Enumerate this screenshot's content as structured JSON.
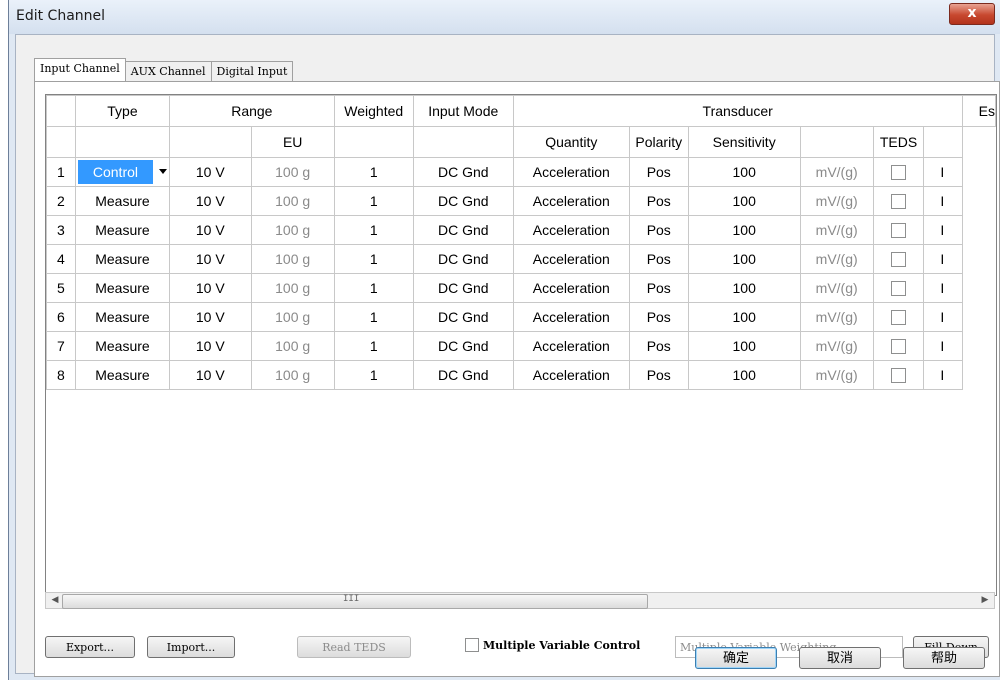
{
  "window": {
    "title": "Edit Channel",
    "close_glyph": "x"
  },
  "tabs": [
    {
      "label": "Input Channel"
    },
    {
      "label": "AUX Channel"
    },
    {
      "label": "Digital Input"
    }
  ],
  "grid": {
    "headers_top": {
      "type": "Type",
      "range": "Range",
      "weighted": "Weighted",
      "input_mode": "Input Mode",
      "transducer": "Transducer",
      "es": "Es"
    },
    "headers_sub": {
      "eu": "EU",
      "quantity": "Quantity",
      "polarity": "Polarity",
      "sensitivity": "Sensitivity",
      "teds": "TEDS"
    },
    "rows": [
      {
        "num": "1",
        "type": "Control",
        "range": "10 V",
        "eu": "100 g",
        "weighted": "1",
        "input_mode": "DC Gnd",
        "quantity": "Acceleration",
        "polarity": "Pos",
        "sensitivity": "100",
        "unit": "mV/(g)",
        "edge": "I"
      },
      {
        "num": "2",
        "type": "Measure",
        "range": "10 V",
        "eu": "100 g",
        "weighted": "1",
        "input_mode": "DC Gnd",
        "quantity": "Acceleration",
        "polarity": "Pos",
        "sensitivity": "100",
        "unit": "mV/(g)",
        "edge": "I"
      },
      {
        "num": "3",
        "type": "Measure",
        "range": "10 V",
        "eu": "100 g",
        "weighted": "1",
        "input_mode": "DC Gnd",
        "quantity": "Acceleration",
        "polarity": "Pos",
        "sensitivity": "100",
        "unit": "mV/(g)",
        "edge": "I"
      },
      {
        "num": "4",
        "type": "Measure",
        "range": "10 V",
        "eu": "100 g",
        "weighted": "1",
        "input_mode": "DC Gnd",
        "quantity": "Acceleration",
        "polarity": "Pos",
        "sensitivity": "100",
        "unit": "mV/(g)",
        "edge": "I"
      },
      {
        "num": "5",
        "type": "Measure",
        "range": "10 V",
        "eu": "100 g",
        "weighted": "1",
        "input_mode": "DC Gnd",
        "quantity": "Acceleration",
        "polarity": "Pos",
        "sensitivity": "100",
        "unit": "mV/(g)",
        "edge": "I"
      },
      {
        "num": "6",
        "type": "Measure",
        "range": "10 V",
        "eu": "100 g",
        "weighted": "1",
        "input_mode": "DC Gnd",
        "quantity": "Acceleration",
        "polarity": "Pos",
        "sensitivity": "100",
        "unit": "mV/(g)",
        "edge": "I"
      },
      {
        "num": "7",
        "type": "Measure",
        "range": "10 V",
        "eu": "100 g",
        "weighted": "1",
        "input_mode": "DC Gnd",
        "quantity": "Acceleration",
        "polarity": "Pos",
        "sensitivity": "100",
        "unit": "mV/(g)",
        "edge": "I"
      },
      {
        "num": "8",
        "type": "Measure",
        "range": "10 V",
        "eu": "100 g",
        "weighted": "1",
        "input_mode": "DC Gnd",
        "quantity": "Acceleration",
        "polarity": "Pos",
        "sensitivity": "100",
        "unit": "mV/(g)",
        "edge": "I"
      }
    ]
  },
  "scrollbar": {
    "left_arrow": "◀",
    "right_arrow": "▶",
    "grip": "III"
  },
  "buttons": {
    "export": "Export...",
    "import": "Import...",
    "read_teds": "Read TEDS",
    "multiple_variable_control": "Multiple Variable Control",
    "multiple_variable_weighting": "Multiple Variable Weighting",
    "fill_down": "Fill Down",
    "ok": "确定",
    "cancel": "取消",
    "help": "帮助"
  }
}
